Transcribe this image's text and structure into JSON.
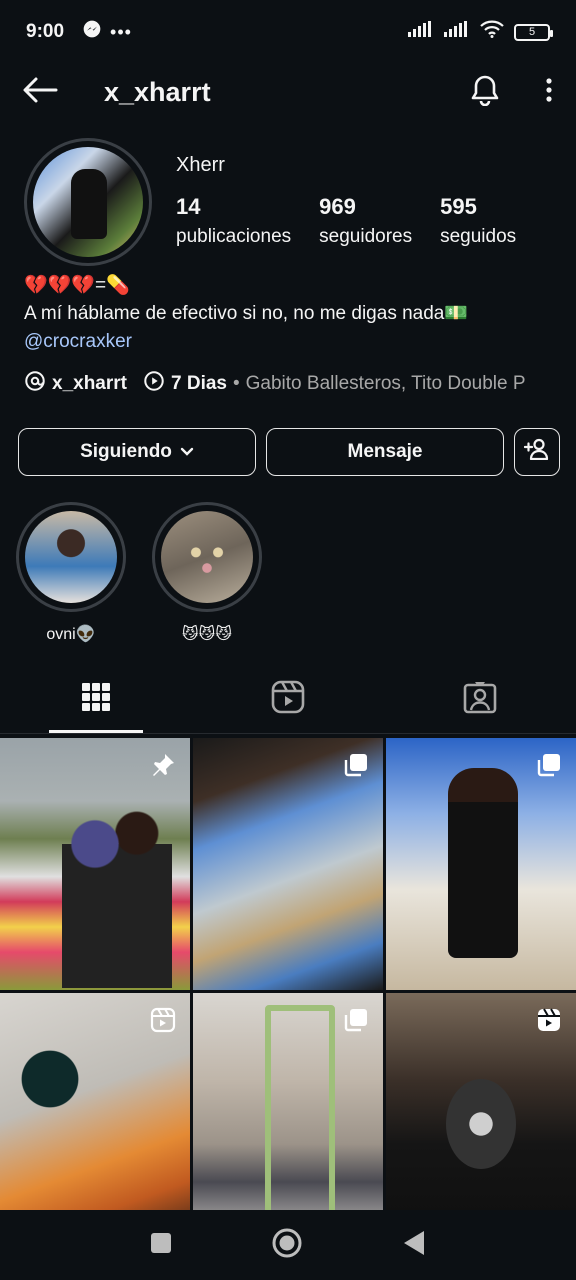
{
  "status_bar": {
    "time": "9:00",
    "battery": "5"
  },
  "header": {
    "username": "x_xharrt"
  },
  "profile": {
    "display_name": "Xherr",
    "stats": [
      {
        "value": "14",
        "label": "publicaciones"
      },
      {
        "value": "969",
        "label": "seguidores"
      },
      {
        "value": "595",
        "label": "seguidos"
      }
    ],
    "bio_line1": "💔💔💔=💊",
    "bio_line2": "A mí háblame de efectivo si no, no me digas nada💵",
    "bio_link": "@crocraxker",
    "threads_handle": "x_xharrt",
    "music_title": "7 Dias",
    "music_artists": "Gabito Ballesteros, Tito Double P"
  },
  "actions": {
    "follow_label": "Siguiendo",
    "message_label": "Mensaje"
  },
  "highlights": [
    {
      "label": "ovni👽"
    },
    {
      "label": "😼😼😼"
    }
  ],
  "icons": {
    "back": "arrow-left-icon",
    "bell": "bell-icon",
    "more": "more-vertical-icon",
    "threads": "threads-icon",
    "play": "play-circle-icon",
    "chevron": "chevron-down-icon",
    "add_person": "add-person-icon",
    "grid": "grid-icon",
    "reels": "reels-icon",
    "tagged": "tagged-icon"
  },
  "colors": {
    "background": "#0c1014",
    "link": "#a8c7fa",
    "muted": "#a8a8a8"
  }
}
